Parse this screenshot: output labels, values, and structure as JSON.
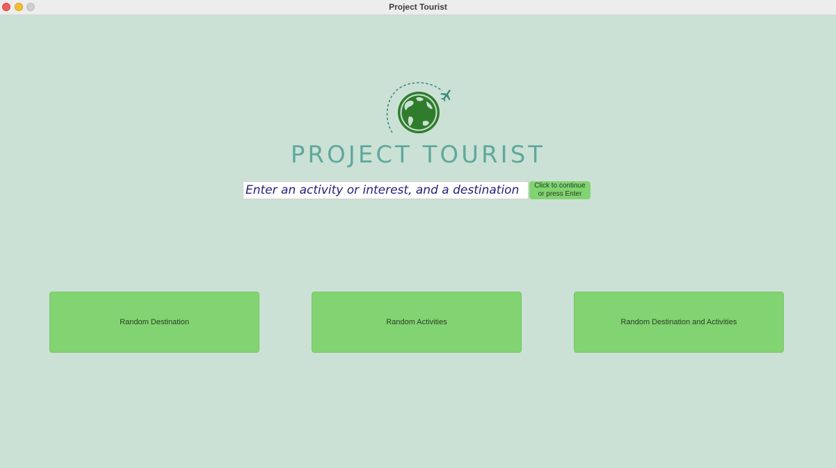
{
  "window": {
    "title": "Project Tourist"
  },
  "logo": {
    "text": "PROJECT TOURIST",
    "icon": "globe-with-airplane-icon",
    "colors": {
      "globe": "#2f7d2c",
      "text": "#5fa99c",
      "path": "#3c8a7c"
    }
  },
  "search": {
    "value": "Enter an activity or interest, and a destination"
  },
  "continue_button": {
    "line1": "Click to continue",
    "line2": "or press Enter"
  },
  "actions": [
    {
      "label": "Random Destination"
    },
    {
      "label": "Random Activities"
    },
    {
      "label": "Random Destination and Activities"
    }
  ],
  "colors": {
    "background": "#cbe1d5",
    "button": "#82d371",
    "input_text": "#24207a"
  }
}
